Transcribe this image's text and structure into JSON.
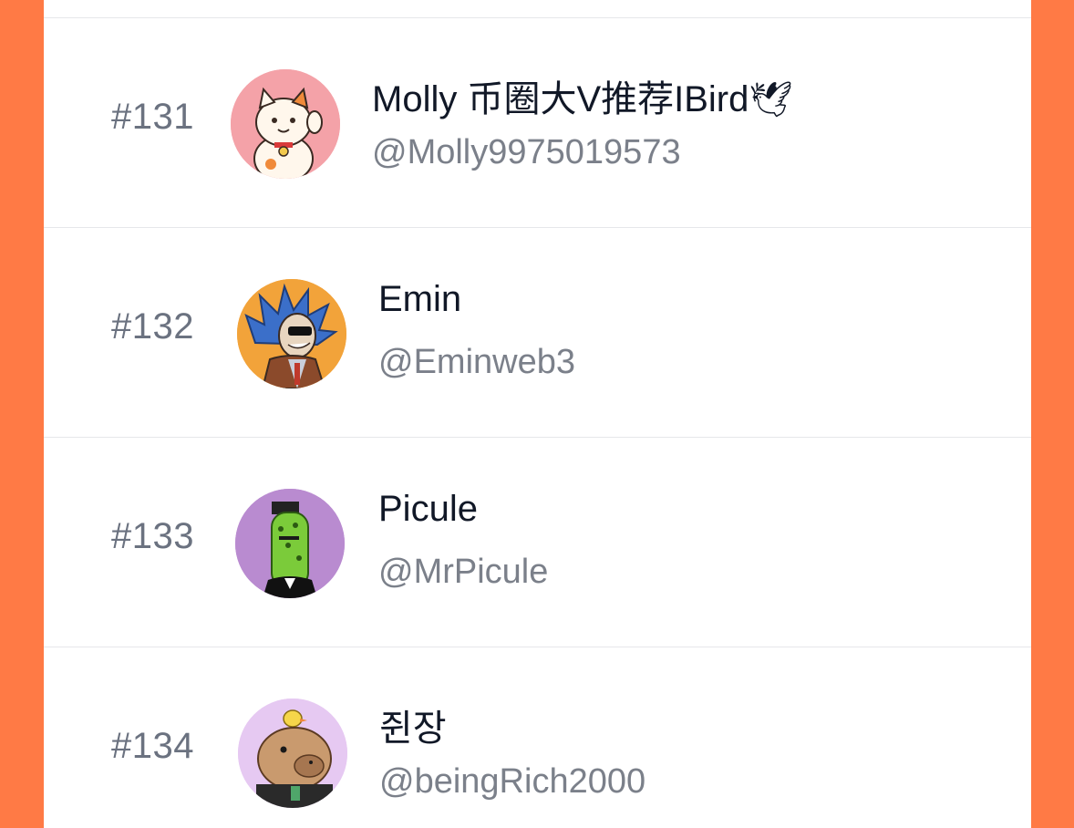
{
  "leaderboard": {
    "rows": [
      {
        "rank": "#131",
        "name": "Molly 币圈大V推荐IBird",
        "emoji": "🕊",
        "handle": "@Molly9975019573",
        "avatar_icon": "lucky-cat-avatar",
        "avatar_bg": "#F4A2A8"
      },
      {
        "rank": "#132",
        "name": "Emin",
        "handle": "@Eminweb3",
        "avatar_icon": "blue-hair-character-avatar",
        "avatar_bg": "#F2A33A"
      },
      {
        "rank": "#133",
        "name": "Picule",
        "handle": "@MrPicule",
        "avatar_icon": "pickle-avatar",
        "avatar_bg": "#B98BD0"
      },
      {
        "rank": "#134",
        "name": "쥔장",
        "handle": "@beingRich2000",
        "avatar_icon": "capybara-avatar",
        "avatar_bg": "#E6C9F2"
      }
    ]
  },
  "colors": {
    "frame": "#FF7A45",
    "rank_text": "#6b7280",
    "name_text": "#111827",
    "handle_text": "#7b808a",
    "divider": "#e6e7ea"
  }
}
